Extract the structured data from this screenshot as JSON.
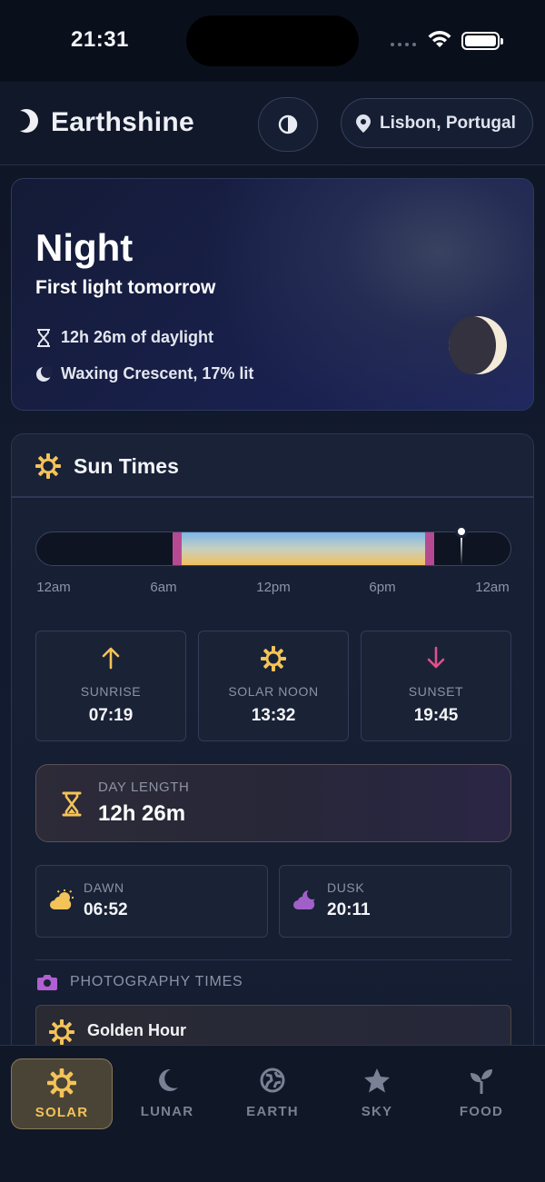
{
  "status_bar": {
    "time": "21:31"
  },
  "header": {
    "title": "Earthshine",
    "location": "Lisbon, Portugal"
  },
  "hero": {
    "state": "Night",
    "subtitle": "First light tomorrow",
    "daylight": "12h 26m of daylight",
    "moon_phase": "Waxing Crescent, 17% lit",
    "moon_illumination": 0.17
  },
  "sun_times": {
    "title": "Sun Times",
    "timeline_labels": [
      "12am",
      "6am",
      "12pm",
      "6pm",
      "12am"
    ],
    "sunrise": {
      "label": "SUNRISE",
      "value": "07:19"
    },
    "solar_noon": {
      "label": "SOLAR NOON",
      "value": "13:32"
    },
    "sunset": {
      "label": "SUNSET",
      "value": "19:45"
    },
    "day_length": {
      "label": "DAY LENGTH",
      "value": "12h 26m"
    },
    "dawn": {
      "label": "DAWN",
      "value": "06:52"
    },
    "dusk": {
      "label": "DUSK",
      "value": "20:11"
    },
    "photography": {
      "heading": "PHOTOGRAPHY TIMES",
      "golden_hour": "Golden Hour"
    }
  },
  "tabs": [
    {
      "label": "SOLAR",
      "icon": "sun-icon",
      "active": true
    },
    {
      "label": "LUNAR",
      "icon": "moon-icon",
      "active": false
    },
    {
      "label": "EARTH",
      "icon": "globe-icon",
      "active": false
    },
    {
      "label": "SKY",
      "icon": "star-icon",
      "active": false
    },
    {
      "label": "FOOD",
      "icon": "sprout-icon",
      "active": false
    }
  ],
  "colors": {
    "accent": "#f4c358",
    "sunrise": "#f4c358",
    "sunset": "#e0508a",
    "dusk": "#a060c8",
    "camera": "#b060d0"
  }
}
